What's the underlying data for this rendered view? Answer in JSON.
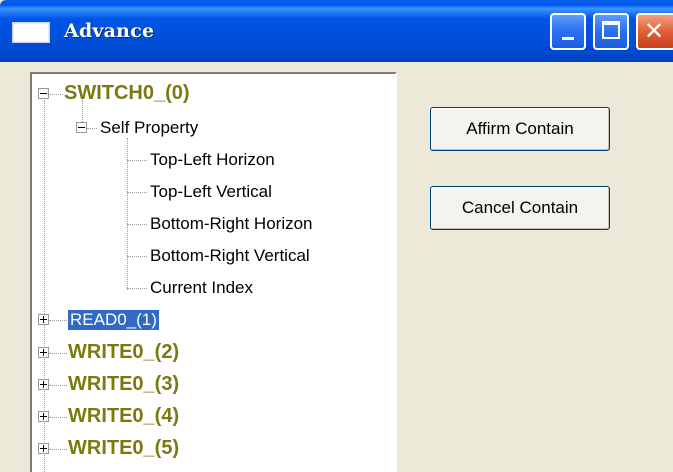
{
  "window": {
    "title": "Advance",
    "title_bar_color": "#0054E3"
  },
  "tree": {
    "root": {
      "label": "SWITCH0_(0)",
      "expanded": true
    },
    "self_property": {
      "label": "Self Property",
      "expanded": true
    },
    "properties": [
      "Top-Left Horizon",
      "Top-Left Vertical",
      "Bottom-Right Horizon",
      "Bottom-Right Vertical",
      "Current Index"
    ],
    "nodes": [
      {
        "label": "READ0_(1)",
        "selected": true
      },
      {
        "label": "WRITE0_(2)"
      },
      {
        "label": "WRITE0_(3)"
      },
      {
        "label": "WRITE0_(4)"
      },
      {
        "label": "WRITE0_(5)"
      }
    ]
  },
  "buttons": {
    "affirm": "Affirm Contain",
    "cancel": "Cancel Contain"
  }
}
